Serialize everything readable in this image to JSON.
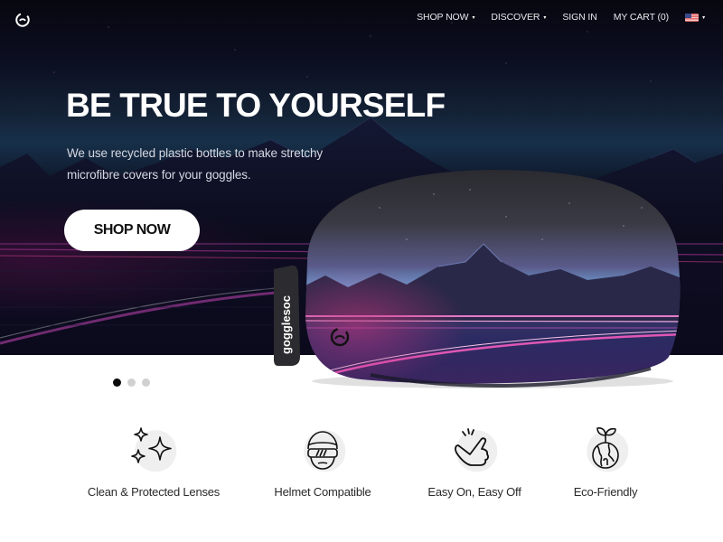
{
  "nav": {
    "logo_icon": "gogglesoc-logo-icon",
    "links": [
      {
        "label": "SHOP NOW",
        "has_dropdown": true
      },
      {
        "label": "DISCOVER",
        "has_dropdown": true
      },
      {
        "label": "SIGN IN",
        "has_dropdown": false
      },
      {
        "label": "MY CART (0)",
        "has_dropdown": false
      }
    ],
    "locale": {
      "icon": "us-flag-icon",
      "has_dropdown": true
    },
    "caret": "▾"
  },
  "hero": {
    "headline": "BE TRUE TO YOURSELF",
    "subtext": "We use recycled plastic bottles to make stretchy microfibre covers for your goggles.",
    "cta_label": "SHOP NOW",
    "product_brand_tag": "gogglesoc",
    "colors": {
      "neon_pink": "#d63c9c",
      "sky_blue": "#6fa6d6",
      "night": "#0a0a18"
    }
  },
  "carousel": {
    "slide_count": 3,
    "active_index": 0
  },
  "features": [
    {
      "label": "Clean & Protected Lenses",
      "icon": "sparkles-icon"
    },
    {
      "label": "Helmet Compatible",
      "icon": "helmet-goggles-icon"
    },
    {
      "label": "Easy On, Easy Off",
      "icon": "snap-fingers-icon"
    },
    {
      "label": "Eco-Friendly",
      "icon": "globe-sprout-icon"
    }
  ]
}
